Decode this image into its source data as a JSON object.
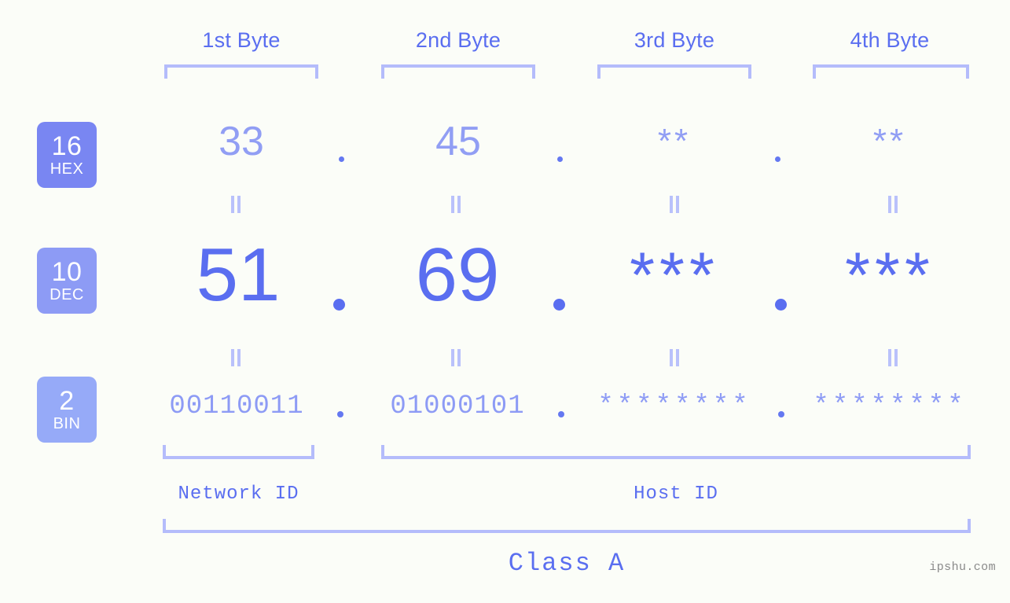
{
  "watermark": "ipshu.com",
  "columns": [
    {
      "title": "1st Byte"
    },
    {
      "title": "2nd Byte"
    },
    {
      "title": "3rd Byte"
    },
    {
      "title": "4th Byte"
    }
  ],
  "bases": [
    {
      "num": "16",
      "abbr": "HEX"
    },
    {
      "num": "10",
      "abbr": "DEC"
    },
    {
      "num": "2",
      "abbr": "BIN"
    }
  ],
  "rows": {
    "hex": {
      "b1": "33",
      "b2": "45",
      "b3": "**",
      "b4": "**"
    },
    "dec": {
      "b1": "51",
      "b2": "69",
      "b3": "***",
      "b4": "***"
    },
    "bin": {
      "b1": "00110011",
      "b2": "01000101",
      "b3": "********",
      "b4": "********"
    }
  },
  "separators": {
    "dot": ".",
    "equals": "="
  },
  "segments": {
    "network_id": "Network ID",
    "host_id": "Host ID",
    "class": "Class A"
  },
  "colors": {
    "background": "#fbfdf8",
    "accent_strong": "#5a6ef0",
    "accent_mid": "#8d9bf5",
    "accent_light": "#b4bcfb",
    "badge_hex": "#7986f2",
    "badge_dec": "#8d9bf5",
    "badge_bin": "#96aaf8",
    "watermark": "#8a8a8a"
  }
}
